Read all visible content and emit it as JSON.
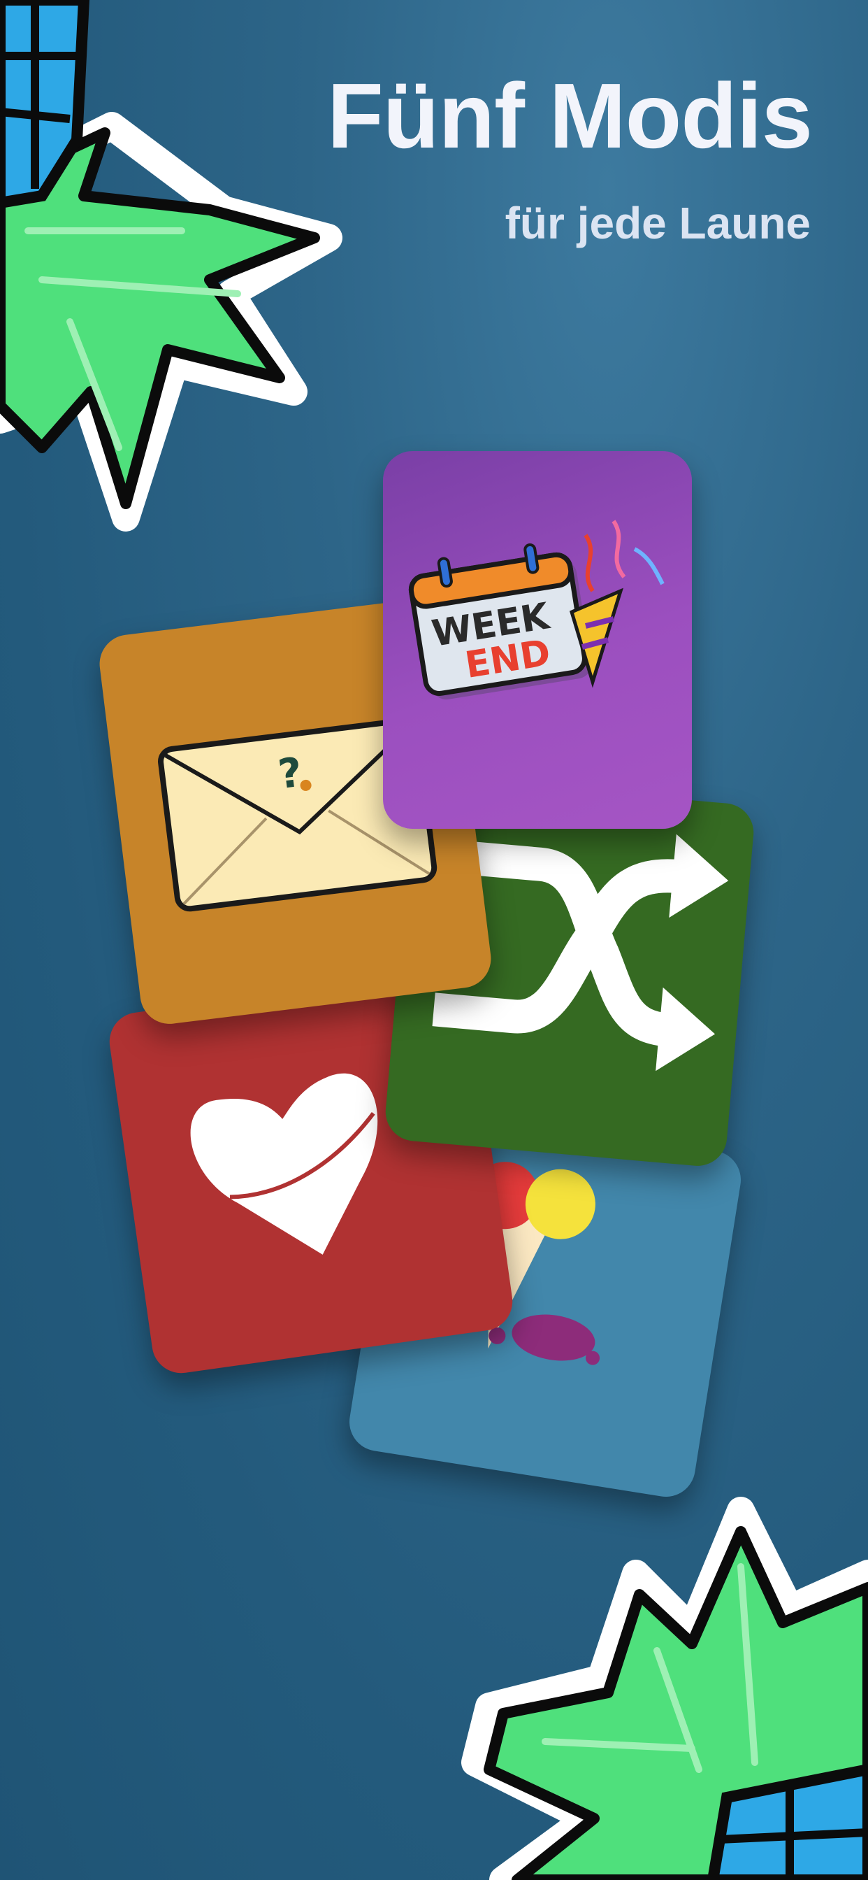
{
  "header": {
    "title": "Fünf Modis",
    "subtitle": "für jede Laune"
  },
  "decorations": {
    "top_left": "pineapple-icon",
    "bottom_right": "pineapple-icon"
  },
  "mode_cards": [
    {
      "icon": "envelope-question-icon",
      "color": "#c78429"
    },
    {
      "icon": "weekend-calendar-icon",
      "color": "#9b4fbf",
      "label": [
        "WEEK",
        "END"
      ]
    },
    {
      "icon": "shuffle-arrows-icon",
      "color": "#356a22"
    },
    {
      "icon": "heart-icon",
      "color": "#b03232"
    },
    {
      "icon": "ice-cream-icon",
      "color": "#4287ab"
    }
  ],
  "colors": {
    "background": "#2a6385",
    "text": "#f2f4fb"
  }
}
